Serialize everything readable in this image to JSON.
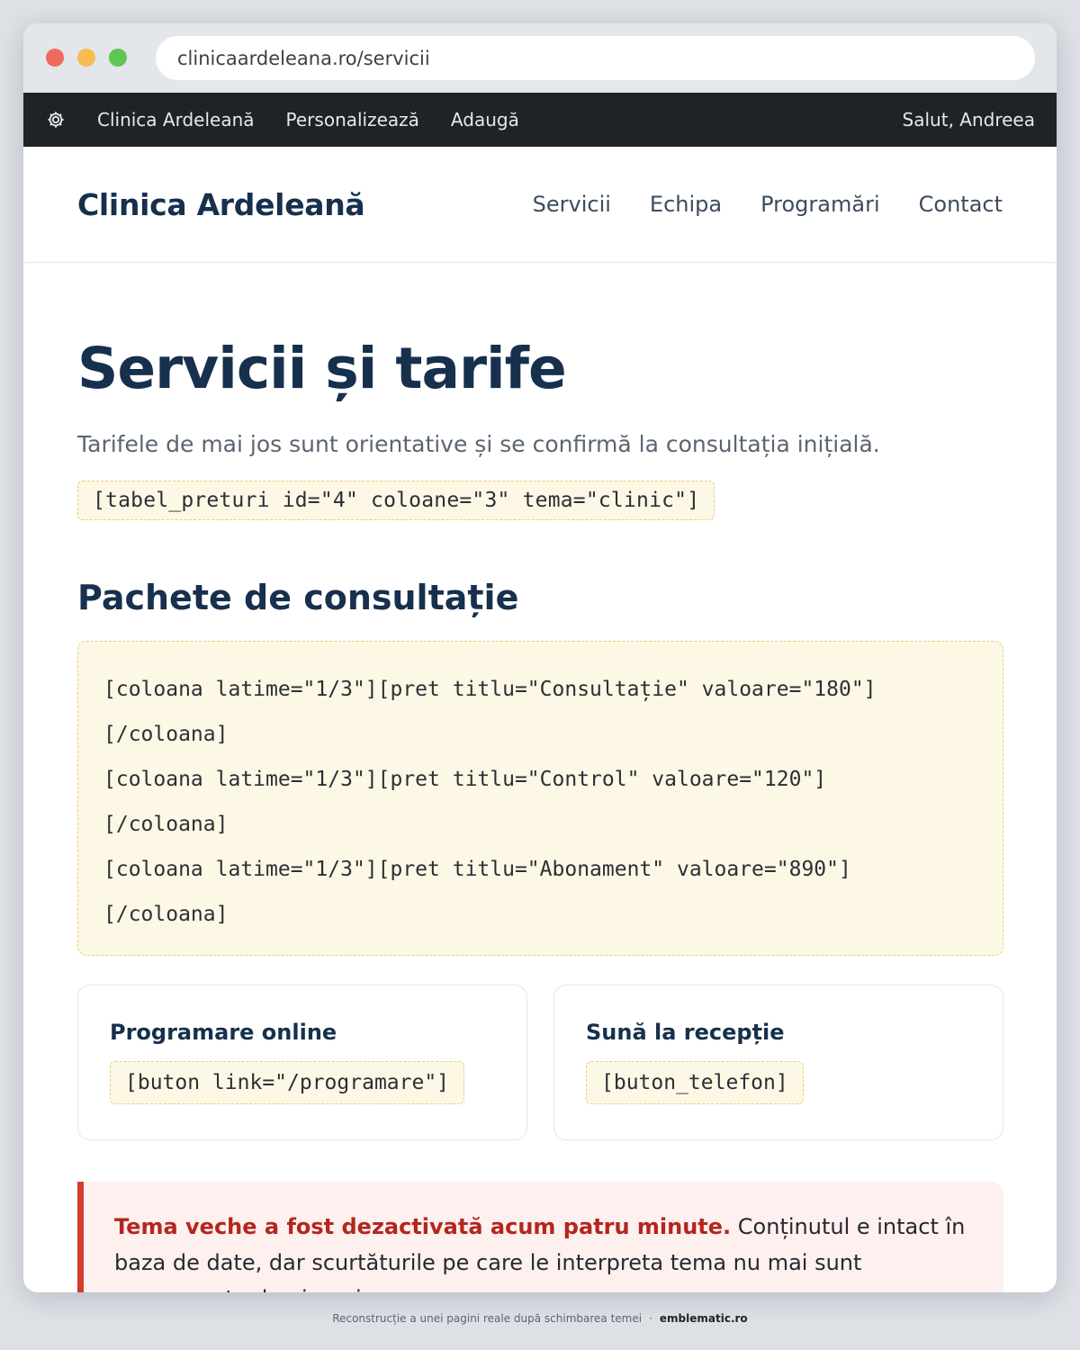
{
  "browser": {
    "url": "clinicaardeleana.ro/servicii"
  },
  "admin_bar": {
    "icon": "gear-icon",
    "items": [
      "Clinica Ardeleană",
      "Personalizează",
      "Adaugă"
    ],
    "greeting": "Salut, Andreea"
  },
  "site": {
    "brand": "Clinica Ardeleană",
    "nav": [
      "Servicii",
      "Echipa",
      "Programări",
      "Contact"
    ]
  },
  "page": {
    "title": "Servicii și tarife",
    "lead": "Tarifele de mai jos sunt orientative și se confirmă la consultația inițială.",
    "shortcode_table": "[tabel_preturi id=\"4\" coloane=\"3\" tema=\"clinic\"]",
    "section_title": "Pachete de consultație",
    "shortcode_lines": [
      "[coloana latime=\"1/3\"][pret titlu=\"Consultație\" valoare=\"180\"]",
      "[/coloana]",
      "[coloana latime=\"1/3\"][pret titlu=\"Control\" valoare=\"120\"]",
      "[/coloana]",
      "[coloana latime=\"1/3\"][pret titlu=\"Abonament\" valoare=\"890\"]",
      "[/coloana]"
    ],
    "cards": [
      {
        "title": "Programare online",
        "shortcode": "[buton link=\"/programare\"]"
      },
      {
        "title": "Sună la recepție",
        "shortcode": "[buton_telefon]"
      }
    ],
    "notice": {
      "strong": "Tema veche a fost dezactivată acum patru minute.",
      "text": " Conținutul e intact în baza de date, dar scurtăturile pe care le interpreta tema nu mai sunt recunoscute de nimeni,"
    }
  },
  "footer": {
    "caption": "Reconstrucție a unei pagini reale după schimbarea temei",
    "separator": "·",
    "brand": "emblematic.ro"
  },
  "colors": {
    "admin_bar": "#1e2327",
    "heading": "#16304d",
    "shortcode_bg": "#fdf8e6",
    "notice_accent": "#d33b2e"
  }
}
